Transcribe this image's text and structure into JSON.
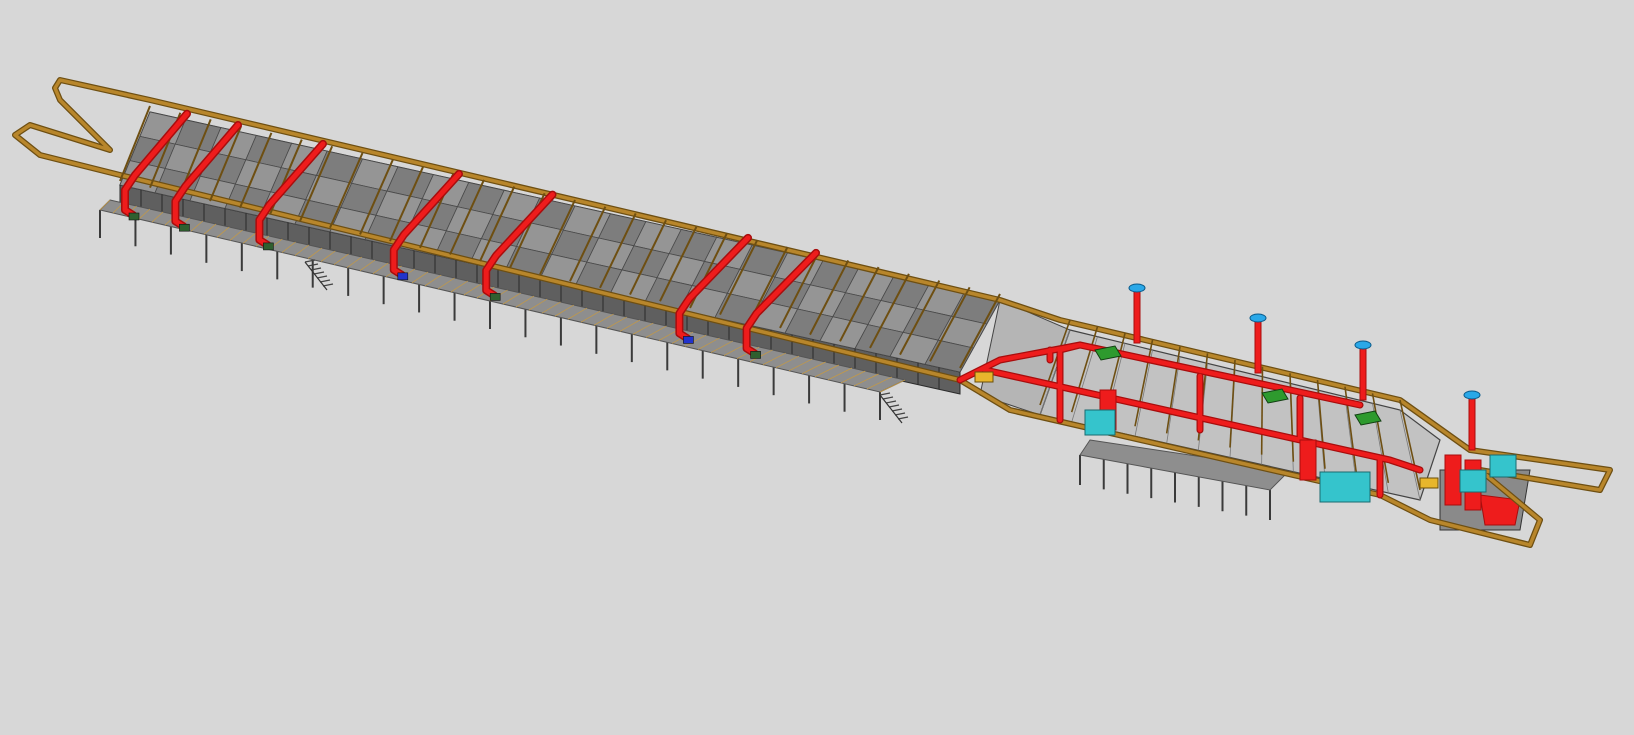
{
  "scene": {
    "background": "#d7d7d7",
    "colors": {
      "conveyor": "#b8862b",
      "conveyor_dark": "#6e4f12",
      "steel": "#3a3a3a",
      "roof_light": "#a9a9a9",
      "roof_dark": "#7d7d7d",
      "side_wall": "#5f5f5f",
      "ductwork": "#ee1c1c",
      "ductwork_dark": "#a80d0d",
      "burner_green": "#2e9a2e",
      "pump_blue": "#2233cc",
      "cabinet_cyan": "#35c4cc",
      "cap_blue": "#2aa8e8",
      "platform_grating": "#8e8e8e",
      "hopper_grey": "#b5b5b5"
    },
    "icons": [
      "conveyor-loop-icon",
      "exhaust-stack-icon",
      "burner-icon",
      "pump-icon"
    ]
  }
}
